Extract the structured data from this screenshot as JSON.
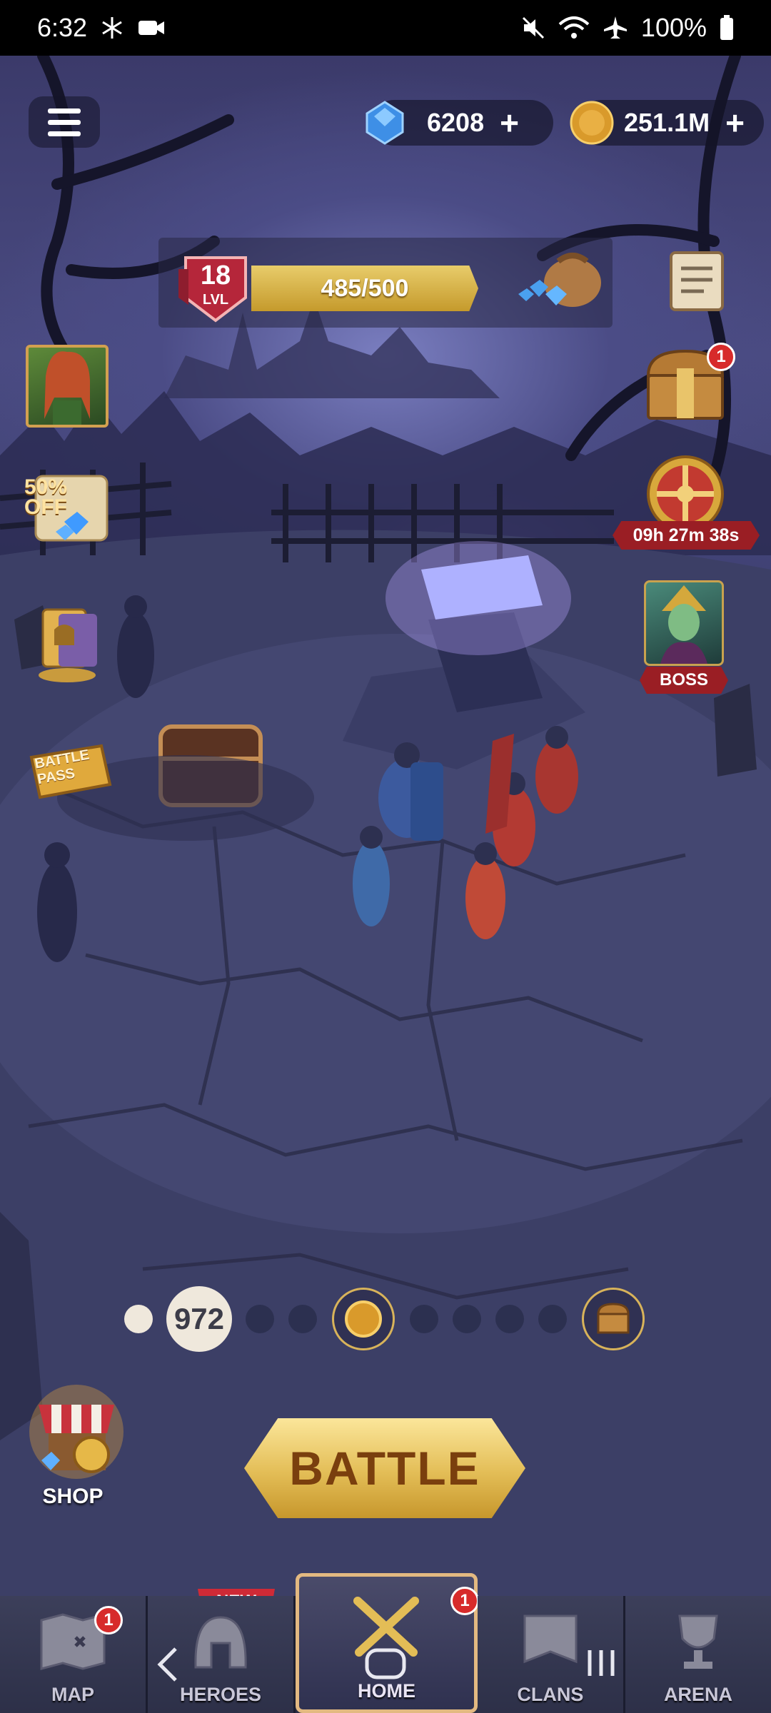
{
  "status_bar": {
    "time": "6:32",
    "battery": "100%",
    "icons": [
      "snowflake-icon",
      "camera-icon",
      "mute-icon",
      "wifi-icon",
      "airplane-icon",
      "battery-icon"
    ]
  },
  "currencies": {
    "gems": "6208",
    "gold": "251.1M",
    "plus": "+"
  },
  "level": {
    "number": "18",
    "label": "LVL",
    "xp": "485/500"
  },
  "side_left": {
    "sale_line1": "50%",
    "sale_line2": "OFF",
    "battle_pass_line1": "BATTLE",
    "battle_pass_line2": "PASS"
  },
  "side_right": {
    "chest_badge": "1",
    "timer": "09h 27m 38s",
    "boss_label": "BOSS"
  },
  "progress": {
    "count": "972"
  },
  "shop_label": "SHOP",
  "battle_label": "BATTLE",
  "nav": {
    "new_tag": "NEW",
    "tabs": [
      {
        "label": "MAP",
        "badge": "1"
      },
      {
        "label": "HEROES"
      },
      {
        "label": "HOME",
        "badge": "1"
      },
      {
        "label": "CLANS"
      },
      {
        "label": "ARENA"
      }
    ]
  },
  "colors": {
    "gold": "#e3bd56",
    "badge_red": "#d72b2b",
    "ribbon_red": "#9a1e24",
    "nav_bg": "#2a2d45"
  }
}
